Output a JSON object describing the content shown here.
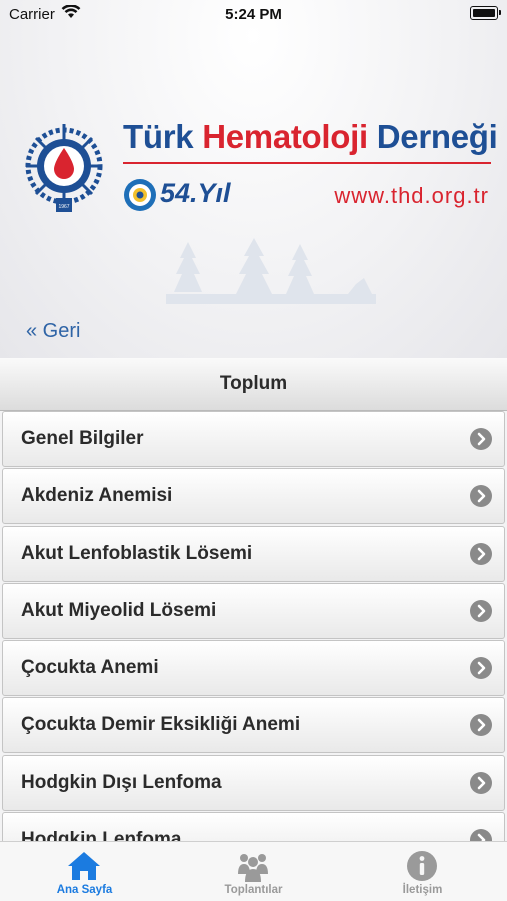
{
  "status_bar": {
    "carrier": "Carrier",
    "time": "5:24 PM"
  },
  "header": {
    "brand": {
      "part1": "Türk ",
      "part2": "Hematoloji",
      "part3": " Derneği"
    },
    "anniversary": "54.Yıl",
    "website": "www.thd.org.tr",
    "emblem_year": "1967",
    "colors": {
      "brand_blue": "#1e4f95",
      "brand_red": "#d9242f"
    }
  },
  "navigation": {
    "back_label": "« Geri"
  },
  "section": {
    "title": "Toplum"
  },
  "list": {
    "items": [
      {
        "label": "Genel Bilgiler"
      },
      {
        "label": "Akdeniz Anemisi"
      },
      {
        "label": "Akut Lenfoblastik Lösemi"
      },
      {
        "label": "Akut Miyeolid Lösemi"
      },
      {
        "label": "Çocukta Anemi"
      },
      {
        "label": "Çocukta Demir Eksikliği Anemi"
      },
      {
        "label": "Hodgkin Dışı Lenfoma"
      },
      {
        "label": "Hodgkin Lenfoma"
      }
    ],
    "chevron_icon": "chevron-right-circle-icon"
  },
  "tab_bar": {
    "tabs": [
      {
        "label": "Ana Sayfa",
        "icon": "home-icon",
        "active": true
      },
      {
        "label": "Toplantılar",
        "icon": "people-icon",
        "active": false
      },
      {
        "label": "İletişim",
        "icon": "info-icon",
        "active": false
      }
    ],
    "colors": {
      "active": "#1b7be0",
      "inactive": "#9a9a9a"
    }
  }
}
